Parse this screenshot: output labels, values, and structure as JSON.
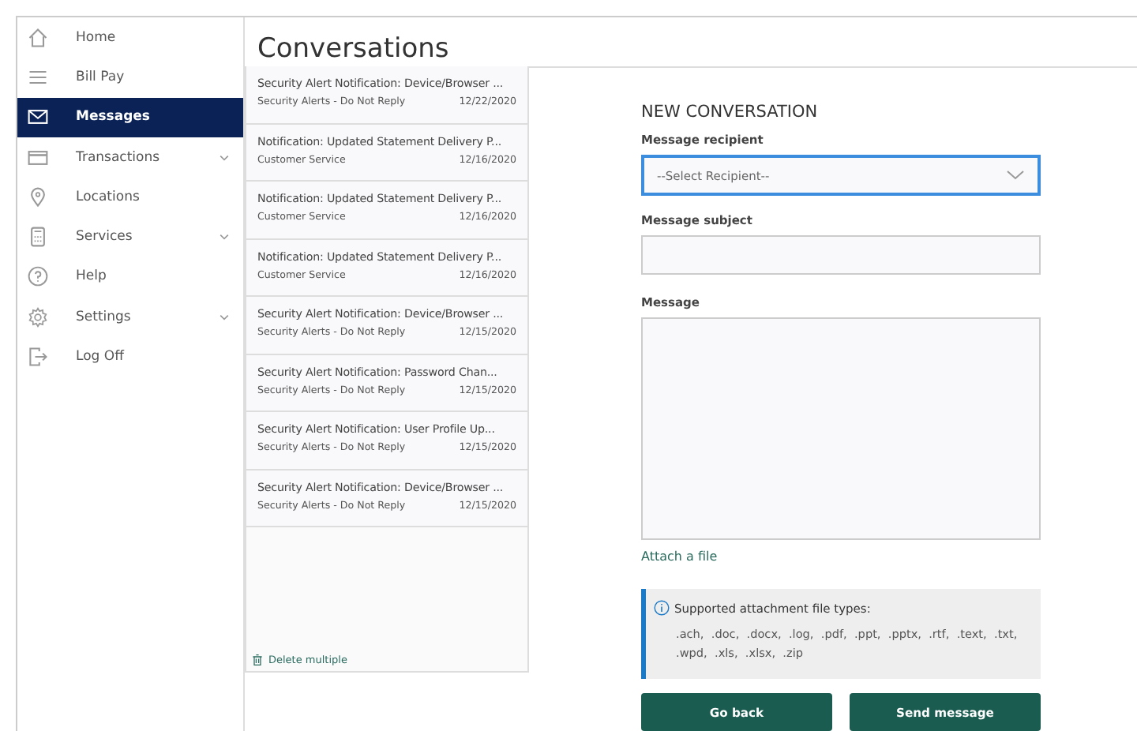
{
  "sidebar": {
    "items": [
      {
        "label": "Home",
        "selected": false,
        "expandable": false
      },
      {
        "label": "Bill Pay",
        "selected": false,
        "expandable": false
      },
      {
        "label": "Messages",
        "selected": true,
        "expandable": false
      },
      {
        "label": "Transactions",
        "selected": false,
        "expandable": true
      },
      {
        "label": "Locations",
        "selected": false,
        "expandable": false
      },
      {
        "label": "Services",
        "selected": false,
        "expandable": true
      },
      {
        "label": "Help",
        "selected": false,
        "expandable": false
      },
      {
        "label": "Settings",
        "selected": false,
        "expandable": true
      },
      {
        "label": "Log Off",
        "selected": false,
        "expandable": false
      }
    ]
  },
  "page_title": "Conversations",
  "conversations": [
    {
      "subject": "Security Alert Notification: Device/Browser ...",
      "sender": "Security Alerts - Do Not Reply",
      "date": "12/22/2020"
    },
    {
      "subject": "Notification: Updated Statement Delivery P...",
      "sender": "Customer Service",
      "date": "12/16/2020"
    },
    {
      "subject": "Notification: Updated Statement Delivery P...",
      "sender": "Customer Service",
      "date": "12/16/2020"
    },
    {
      "subject": "Notification: Updated Statement Delivery P...",
      "sender": "Customer Service",
      "date": "12/16/2020"
    },
    {
      "subject": "Security Alert Notification: Device/Browser ...",
      "sender": "Security Alerts - Do Not Reply",
      "date": "12/15/2020"
    },
    {
      "subject": "Security Alert Notification: Password Chan...",
      "sender": "Security Alerts - Do Not Reply",
      "date": "12/15/2020"
    },
    {
      "subject": "Security Alert Notification: User Profile Up...",
      "sender": "Security Alerts - Do Not Reply",
      "date": "12/15/2020"
    },
    {
      "subject": "Security Alert Notification: Device/Browser ...",
      "sender": "Security Alerts - Do Not Reply",
      "date": "12/15/2020"
    }
  ],
  "delete_multiple": "Delete multiple",
  "form": {
    "title": "NEW CONVERSATION",
    "recipient": {
      "label": "Message recipient",
      "placeholder": "--Select Recipient--",
      "focused": true
    },
    "subject": {
      "label": "Message subject"
    },
    "message": {
      "label": "Message"
    },
    "attach": "Attach a file",
    "info": {
      "title": "Supported attachment file types:",
      "text": ".ach,  .doc,  .docx,  .log,  .pdf,  .ppt,  .pptx,  .rtf,  .text,  .txt,  .wpd,  .xls,  .xlsx,  .zip"
    },
    "buttons": [
      "Go back",
      "Send message"
    ]
  }
}
